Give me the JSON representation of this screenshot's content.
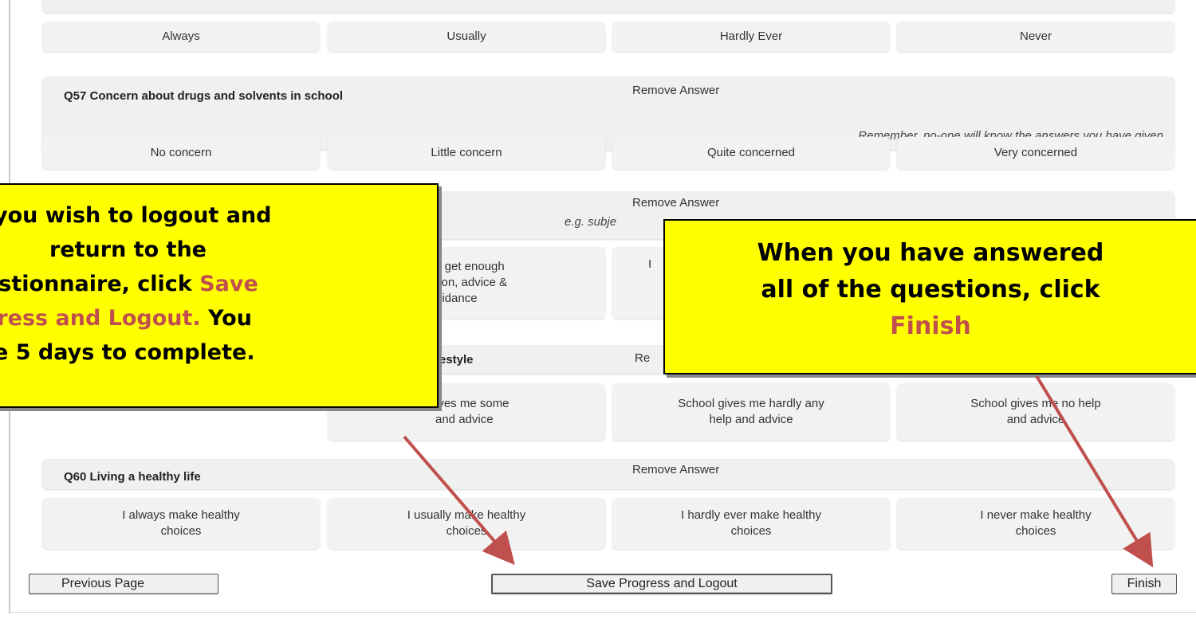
{
  "q56": {
    "options": [
      "Always",
      "Usually",
      "Hardly Ever",
      "Never"
    ]
  },
  "q57": {
    "title": "Q57 Concern about drugs and solvents in school",
    "remove": "Remove Answer",
    "hint": "Remember, no-one will know the answers you have given",
    "options": [
      "No concern",
      "Little concern",
      "Quite concerned",
      "Very concerned"
    ]
  },
  "q58": {
    "remove": "Remove Answer",
    "hint_visible": "e.g. subje",
    "opt2_visible": [
      "y get enough",
      "tion, advice &",
      "uidance"
    ],
    "opt3_visible": "I"
  },
  "q59": {
    "title_visible": "festyle",
    "remove_visible": "Re",
    "opt2_visible": [
      "ives me some",
      "and advice"
    ],
    "opt3": "School gives me hardly any help and advice",
    "opt4": "School gives me no help and advice"
  },
  "q60": {
    "title": "Q60 Living a healthy life",
    "remove": "Remove Answer",
    "options": [
      "I always make healthy choices",
      "I usually make healthy choices",
      "I hardly ever make healthy choices",
      "I never make healthy choices"
    ]
  },
  "buttons": {
    "previous": "Previous Page",
    "save": "Save Progress and Logout",
    "finish": "Finish"
  },
  "callout_left": {
    "line1": "you wish to logout and",
    "line2": "return to the",
    "line3_pre": "estionnaire, click ",
    "line3_hl": "Save",
    "line4_hl": "gress and Logout.",
    "line4_post": " You",
    "line5": "e 5 days to complete."
  },
  "callout_right": {
    "line1": "When you have answered",
    "line2": "all of the questions, click",
    "line3_hl": "Finish"
  },
  "colors": {
    "callout_bg": "#ffff00",
    "highlight_text": "#c0504d",
    "arrow": "#c0504d"
  }
}
